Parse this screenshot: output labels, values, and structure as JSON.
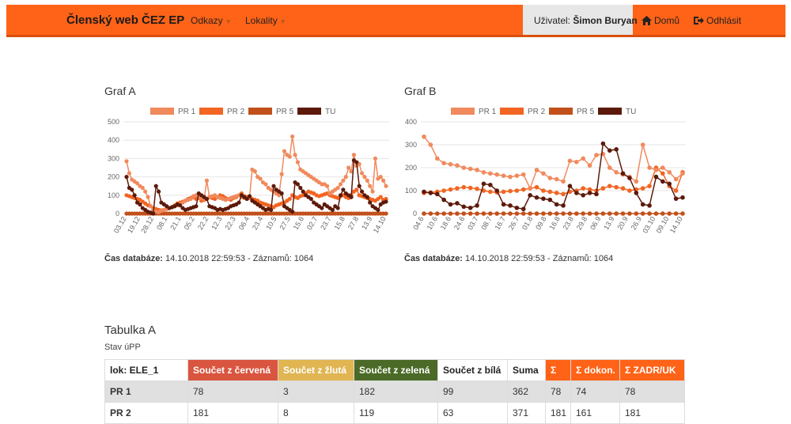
{
  "nav": {
    "brand": "Členský web ČEZ EP",
    "menu": [
      "Odkazy",
      "Lokality"
    ],
    "user_label": "Uživatel:",
    "user_name": "Šimon Buryan",
    "home": "Domů",
    "logout": "Odhlásit"
  },
  "colors": {
    "navbar": "#ff6317",
    "pr1": "#f08a5d",
    "pr2": "#f26522",
    "pr5": "#c1501a",
    "tu": "#5c1a0b",
    "red": "#d9553f",
    "yellow": "#e0b552",
    "green": "#4b6a27",
    "orange": "#ff6317"
  },
  "chart_data": [
    {
      "type": "line",
      "title": "Graf A",
      "ylim": [
        0,
        500
      ],
      "yticks": [
        0,
        100,
        200,
        300,
        400,
        500
      ],
      "x_tick_labels": [
        "03.12",
        "19.12",
        "28.12",
        "08.1",
        "21.1",
        "05.2",
        "22.2",
        "12.3",
        "22.3",
        "06.4",
        "23.4",
        "10.5",
        "27.5",
        "15.6",
        "02.7",
        "23.7",
        "15.8",
        "27.8",
        "13.9",
        "14.10"
      ],
      "legend": [
        "PR 1",
        "PR 2",
        "PR 5",
        "TU"
      ],
      "series": [
        {
          "name": "PR 1",
          "values": [
            285,
            220,
            185,
            175,
            165,
            150,
            140,
            120,
            90,
            40,
            20,
            10,
            8,
            15,
            20,
            25,
            30,
            35,
            40,
            45,
            50,
            60,
            70,
            75,
            80,
            95,
            100,
            90,
            85,
            80,
            180,
            90,
            95,
            100,
            90,
            85,
            80,
            75,
            80,
            85,
            90,
            95,
            100,
            90,
            85,
            80,
            90,
            240,
            230,
            200,
            190,
            170,
            160,
            140,
            130,
            120,
            110,
            100,
            215,
            340,
            320,
            310,
            420,
            320,
            280,
            240,
            230,
            220,
            210,
            200,
            190,
            180,
            170,
            160,
            160,
            150,
            110,
            120,
            130,
            140,
            160,
            180,
            200,
            250,
            230,
            320,
            260,
            270,
            220,
            200,
            180,
            150,
            120,
            300,
            190,
            200,
            180,
            150
          ]
        },
        {
          "name": "PR 2",
          "values": [
            100,
            95,
            90,
            85,
            80,
            75,
            65,
            55,
            45,
            40,
            30,
            25,
            20,
            18,
            20,
            25,
            30,
            35,
            45,
            55,
            60,
            65,
            70,
            80,
            85,
            90,
            80,
            85,
            70,
            75,
            80,
            90,
            85,
            80,
            90,
            100,
            95,
            85,
            80,
            75,
            85,
            90,
            100,
            110,
            95,
            90,
            85,
            80,
            75,
            70,
            60,
            55,
            50,
            45,
            40,
            35,
            45,
            50,
            55,
            60,
            70,
            80,
            100,
            90,
            85,
            95,
            100,
            110,
            120,
            115,
            110,
            100,
            95,
            100,
            105,
            110,
            100,
            95,
            90,
            85,
            95,
            100,
            90,
            85,
            100,
            120,
            130,
            100,
            95,
            90,
            85,
            80,
            75,
            70,
            80,
            90,
            75,
            80
          ]
        },
        {
          "name": "PR 5",
          "values": [
            0,
            0,
            0,
            0,
            0,
            0,
            0,
            0,
            0,
            0,
            0,
            0,
            0,
            0,
            0,
            0,
            0,
            0,
            0,
            0,
            0,
            0,
            0,
            0,
            0,
            0,
            0,
            0,
            0,
            0,
            0,
            0,
            0,
            0,
            0,
            0,
            0,
            0,
            0,
            0,
            0,
            0,
            0,
            0,
            0,
            0,
            0,
            0,
            0,
            0,
            0,
            0,
            0,
            0,
            0,
            0,
            0,
            0,
            0,
            0,
            0,
            0,
            0,
            0,
            0,
            0,
            0,
            0,
            0,
            0,
            0,
            0,
            0,
            0,
            0,
            0,
            0,
            0,
            0,
            0,
            0,
            0,
            0,
            0,
            0,
            0,
            0,
            0,
            0,
            0,
            0,
            0,
            0,
            0,
            0,
            0,
            0,
            0
          ]
        },
        {
          "name": "TU",
          "values": [
            200,
            140,
            130,
            100,
            60,
            50,
            30,
            20,
            10,
            5,
            0,
            150,
            120,
            60,
            50,
            40,
            30,
            35,
            40,
            50,
            45,
            30,
            20,
            25,
            30,
            35,
            40,
            110,
            100,
            90,
            80,
            40,
            35,
            30,
            20,
            25,
            20,
            25,
            30,
            40,
            45,
            50,
            60,
            100,
            90,
            80,
            95,
            70,
            60,
            50,
            40,
            30,
            20,
            25,
            20,
            150,
            130,
            120,
            110,
            40,
            30,
            20,
            10,
            170,
            160,
            140,
            120,
            100,
            90,
            80,
            60,
            50,
            40,
            30,
            50,
            40,
            30,
            20,
            40,
            30,
            100,
            130,
            110,
            100,
            90,
            290,
            280,
            150,
            120,
            100,
            90,
            60,
            40,
            30,
            20,
            50,
            60,
            65
          ]
        }
      ]
    },
    {
      "type": "line",
      "title": "Graf B",
      "ylim": [
        0,
        400
      ],
      "yticks": [
        0,
        100,
        200,
        300,
        400
      ],
      "x_tick_labels": [
        "04.6",
        "10.6",
        "18.6",
        "24.6",
        "03.7",
        "08.7",
        "16.7",
        "26.7",
        "01.8",
        "09.8",
        "16.8",
        "23.8",
        "29.8",
        "06.9",
        "13.9",
        "20.9",
        "26.9",
        "03.10",
        "09.10",
        "14.10"
      ],
      "legend": [
        "PR 1",
        "PR 2",
        "PR 5",
        "TU"
      ],
      "series": [
        {
          "name": "PR 1",
          "values": [
            335,
            300,
            240,
            220,
            215,
            210,
            200,
            195,
            190,
            180,
            175,
            170,
            165,
            160,
            165,
            170,
            110,
            190,
            175,
            155,
            150,
            140,
            230,
            225,
            240,
            210,
            255,
            260,
            200,
            180,
            170,
            160,
            140,
            300,
            200,
            190,
            200,
            180,
            150,
            175
          ]
        },
        {
          "name": "PR 2",
          "values": [
            90,
            92,
            95,
            100,
            105,
            110,
            115,
            112,
            108,
            100,
            95,
            92,
            95,
            98,
            100,
            105,
            110,
            115,
            100,
            95,
            90,
            85,
            95,
            100,
            110,
            105,
            100,
            110,
            120,
            115,
            110,
            100,
            105,
            110,
            120,
            200,
            175,
            120,
            100,
            180
          ]
        },
        {
          "name": "PR 5",
          "values": [
            0,
            0,
            0,
            0,
            0,
            0,
            0,
            0,
            0,
            0,
            0,
            0,
            0,
            0,
            0,
            0,
            0,
            0,
            0,
            0,
            0,
            0,
            0,
            0,
            0,
            0,
            0,
            0,
            0,
            0,
            0,
            0,
            0,
            0,
            0,
            0,
            0,
            0,
            0,
            0
          ]
        },
        {
          "name": "TU",
          "values": [
            95,
            90,
            85,
            60,
            40,
            45,
            30,
            25,
            35,
            130,
            125,
            100,
            40,
            35,
            25,
            20,
            80,
            70,
            65,
            60,
            40,
            35,
            120,
            90,
            80,
            90,
            85,
            305,
            275,
            280,
            175,
            155,
            90,
            40,
            35,
            160,
            140,
            130,
            65,
            70
          ]
        }
      ]
    }
  ],
  "db_info": {
    "label": "Čas databáze:",
    "text": "14.10.2018 22:59:53 - Záznamů: 1064"
  },
  "table": {
    "title": "Tabulka A",
    "subtitle": "Stav úPP",
    "headers": [
      "lok: ELE_1",
      "Součet z červená",
      "Součet z žlutá",
      "Součet z zelená",
      "Součet z bílá",
      "Suma",
      "Σ",
      "Σ dokon.",
      "Σ ZADR/UK"
    ],
    "rows": [
      [
        "PR 1",
        "78",
        "3",
        "182",
        "99",
        "362",
        "78",
        "74",
        "78"
      ],
      [
        "PR 2",
        "181",
        "8",
        "119",
        "63",
        "371",
        "181",
        "161",
        "181"
      ]
    ]
  }
}
